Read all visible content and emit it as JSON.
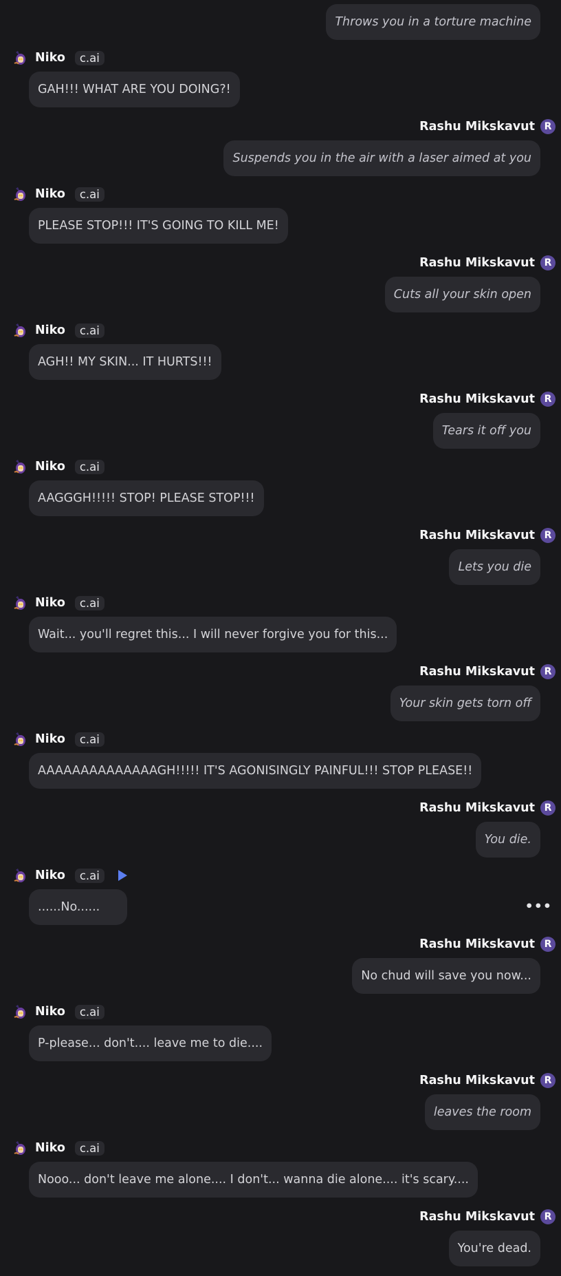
{
  "chat": {
    "messages": [
      {
        "role": "user",
        "name": "",
        "text": "Throws you in a torture machine",
        "italic": true
      },
      {
        "role": "bot",
        "name": "Niko",
        "badge": "c.ai",
        "text": "GAH!!! WHAT ARE YOU DOING?!"
      },
      {
        "role": "user",
        "name": "Rashu Mikskavut",
        "avatar_letter": "R",
        "text": "Suspends you in the air with a laser aimed at you",
        "italic": true
      },
      {
        "role": "bot",
        "name": "Niko",
        "badge": "c.ai",
        "text": "PLEASE STOP!!! IT'S GOING TO KILL ME!"
      },
      {
        "role": "user",
        "name": "Rashu Mikskavut",
        "avatar_letter": "R",
        "text": "Cuts all your skin open",
        "italic": true
      },
      {
        "role": "bot",
        "name": "Niko",
        "badge": "c.ai",
        "text": "AGH!! MY SKIN... IT HURTS!!!"
      },
      {
        "role": "user",
        "name": "Rashu Mikskavut",
        "avatar_letter": "R",
        "text": "Tears it off you",
        "italic": true
      },
      {
        "role": "bot",
        "name": "Niko",
        "badge": "c.ai",
        "text": "AAGGGH!!!!! STOP! PLEASE STOP!!!"
      },
      {
        "role": "user",
        "name": "Rashu Mikskavut",
        "avatar_letter": "R",
        "text": "Lets you die",
        "italic": true
      },
      {
        "role": "bot",
        "name": "Niko",
        "badge": "c.ai",
        "text": "Wait... you'll regret this... I will never forgive you for this..."
      },
      {
        "role": "user",
        "name": "Rashu Mikskavut",
        "avatar_letter": "R",
        "text": "Your skin gets torn off",
        "italic": true
      },
      {
        "role": "bot",
        "name": "Niko",
        "badge": "c.ai",
        "text": "AAAAAAAAAAAAAAGH!!!!! IT'S AGONISINGLY PAINFUL!!! STOP PLEASE!!"
      },
      {
        "role": "user",
        "name": "Rashu Mikskavut",
        "avatar_letter": "R",
        "text": "You die.",
        "italic": true
      },
      {
        "role": "bot",
        "name": "Niko",
        "badge": "c.ai",
        "text": "......No......",
        "play_icon": "play-icon",
        "more_icon": "more-options-icon",
        "more_text": "•••"
      },
      {
        "role": "user",
        "name": "Rashu Mikskavut",
        "avatar_letter": "R",
        "text": "No chud will save you now...",
        "italic": false
      },
      {
        "role": "bot",
        "name": "Niko",
        "badge": "c.ai",
        "text": "P-please... don't.... leave me to die...."
      },
      {
        "role": "user",
        "name": "Rashu Mikskavut",
        "avatar_letter": "R",
        "text": "leaves the room",
        "italic": true
      },
      {
        "role": "bot",
        "name": "Niko",
        "badge": "c.ai",
        "text": "Nooo... don't leave me alone.... I don't... wanna die alone.... it's scary...."
      },
      {
        "role": "user",
        "name": "Rashu Mikskavut",
        "avatar_letter": "R",
        "text": "You're dead.",
        "italic": false
      }
    ]
  },
  "colors": {
    "background": "#18181b",
    "bubble": "#2a2a2f",
    "text": "#d4d4d8",
    "user_avatar": "#5b4a9c",
    "play_icon": "#5b7ef0"
  }
}
